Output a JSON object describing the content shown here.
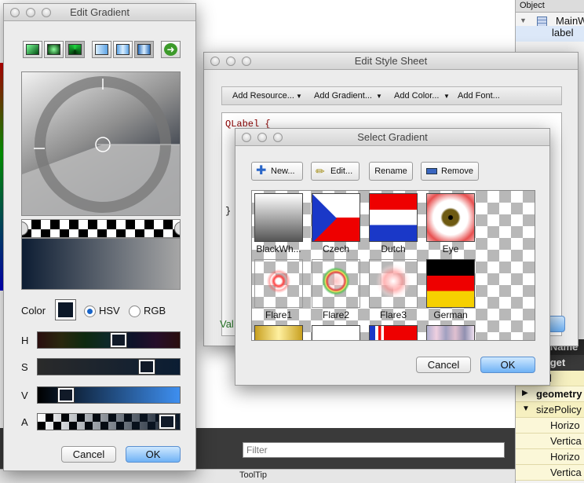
{
  "background": {
    "filter_placeholder": "Filter",
    "status_items": [
      "",
      "",
      "",
      "ToolTip"
    ]
  },
  "inspector": {
    "header": "Object",
    "rows": [
      "MainW",
      "label"
    ],
    "props": [
      {
        "label": "rectName",
        "kind": "dark"
      },
      {
        "label": "Widget",
        "kind": "dark"
      },
      {
        "label": "abled",
        "kind": "yellow"
      },
      {
        "label": "geometry",
        "kind": "yellow2"
      },
      {
        "label": "sizePolicy",
        "kind": "yellow"
      },
      {
        "label": "Horizo",
        "kind": "yellow2"
      },
      {
        "label": "Vertica",
        "kind": "yellow2"
      },
      {
        "label": "Horizo",
        "kind": "yellow2"
      },
      {
        "label": "Vertica",
        "kind": "yellow2"
      }
    ]
  },
  "edit_style_sheet": {
    "title": "Edit Style Sheet",
    "toolbar": {
      "add_resource": "Add Resource...",
      "add_gradient": "Add Gradient...",
      "add_color": "Add Color...",
      "add_font": "Add Font..."
    },
    "code_line1": "QLabel {",
    "code_line_end": "}",
    "valid_label": "Val"
  },
  "edit_gradient": {
    "title": "Edit Gradient",
    "color_label": "Color",
    "hsv_label": "HSV",
    "rgb_label": "RGB",
    "mode_selected": "HSV",
    "current_color": "#0c1828",
    "sliders": [
      {
        "label": "H",
        "value": 0.58
      },
      {
        "label": "S",
        "value": 0.8
      },
      {
        "label": "V",
        "value": 0.16
      },
      {
        "label": "A",
        "value": 0.96
      }
    ],
    "cancel": "Cancel",
    "ok": "OK"
  },
  "select_gradient": {
    "title": "Select Gradient",
    "buttons": {
      "new": "New...",
      "edit": "Edit...",
      "rename": "Rename",
      "remove": "Remove"
    },
    "gradients": [
      "BlackWh...",
      "Czech",
      "Dutch",
      "Eye",
      "Flare1",
      "Flare2",
      "Flare3",
      "German"
    ],
    "cancel": "Cancel",
    "ok": "OK"
  }
}
